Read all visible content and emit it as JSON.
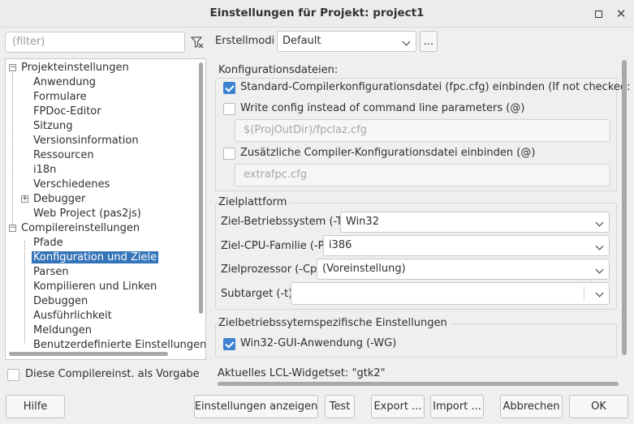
{
  "window": {
    "title": "Einstellungen für Projekt: project1",
    "max_icon": "maximize-icon",
    "close_icon": "close-icon",
    "close_glyph": "✕"
  },
  "filter": {
    "placeholder": "(filter)",
    "clear_icon": "filter-clear-icon"
  },
  "tree": {
    "items": [
      {
        "label": "Projekteinstellungen",
        "toggle": "−"
      },
      {
        "label": "Anwendung"
      },
      {
        "label": "Formulare"
      },
      {
        "label": "FPDoc-Editor"
      },
      {
        "label": "Sitzung"
      },
      {
        "label": "Versionsinformation"
      },
      {
        "label": "Ressourcen"
      },
      {
        "label": "i18n"
      },
      {
        "label": "Verschiedenes"
      },
      {
        "label": "Debugger",
        "toggle": "+"
      },
      {
        "label": "Web Project (pas2js)"
      },
      {
        "label": "Compilereinstellungen",
        "toggle": "−"
      },
      {
        "label": "Pfade"
      },
      {
        "label": "Konfiguration und Ziele",
        "selected": true
      },
      {
        "label": "Parsen"
      },
      {
        "label": "Kompilieren und Linken"
      },
      {
        "label": "Debuggen"
      },
      {
        "label": "Ausführlichkeit"
      },
      {
        "label": "Meldungen"
      },
      {
        "label": "Benutzerdefinierte Einstellungen"
      }
    ]
  },
  "use_as_default": {
    "label": "Diese Compilereinst. als Vorgabe",
    "checked": false
  },
  "buildmodes": {
    "label": "Erstellmodi",
    "value": "Default",
    "more_label": "..."
  },
  "config_files": {
    "title": "Konfigurationsdateien:",
    "standard": {
      "label": "Standard-Compilerkonfigurationsdatei (fpc.cfg) einbinden (If not checked: -n)",
      "checked": true
    },
    "write_config": {
      "label": "Write config instead of command line parameters (@)",
      "checked": false
    },
    "write_config_path": "$(ProjOutDir)/fpclaz.cfg",
    "additional": {
      "label": "Zusätzliche Compiler-Konfigurationsdatei einbinden (@)",
      "checked": false
    },
    "additional_path": "extrafpc.cfg"
  },
  "target": {
    "title": "Zielplattform",
    "os_label": "Ziel-Betriebssystem (-T)",
    "os_value": "Win32",
    "cpu_label": "Ziel-CPU-Familie (-P)",
    "cpu_value": "i386",
    "proc_label": "Zielprozessor (-Cp)",
    "proc_value": "(Voreinstellung)",
    "subtarget_label": "Subtarget (-t)",
    "subtarget_value": ""
  },
  "os_specific": {
    "title": "Zielbetriebssytemspezifische Einstellungen",
    "win32_gui": {
      "label": "Win32-GUI-Anwendung (-WG)",
      "checked": true
    }
  },
  "lcl_widgetset": "Aktuelles LCL-Widgetset: \"gtk2\"",
  "buttons": {
    "help": "Hilfe",
    "show_options": "Einstellungen anzeigen",
    "test": "Test",
    "export": "Export ...",
    "import": "Import ...",
    "cancel": "Abbrechen",
    "ok": "OK"
  },
  "colors": {
    "accent": "#3d82d0",
    "selection": "#3574b8"
  }
}
